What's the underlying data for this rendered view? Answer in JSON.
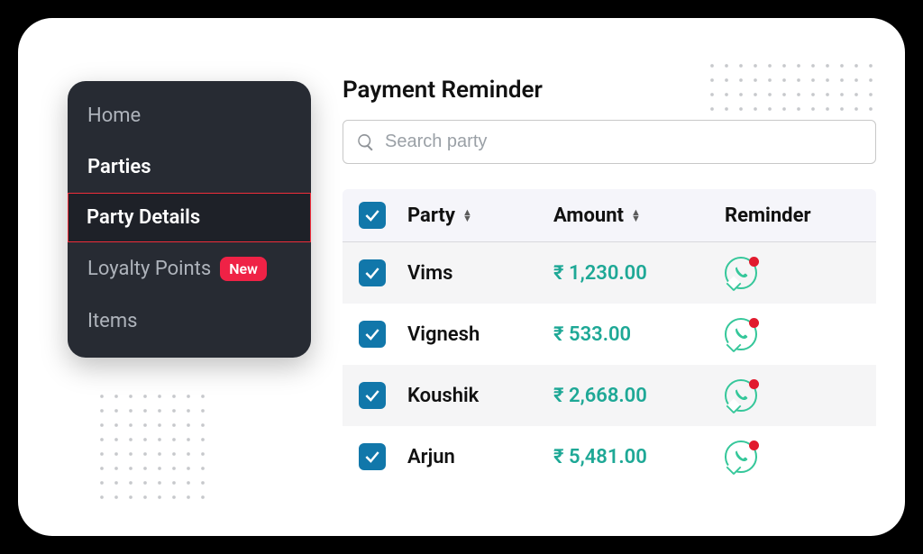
{
  "sidebar": {
    "items": [
      {
        "label": "Home"
      },
      {
        "label": "Parties"
      },
      {
        "label": "Party Details"
      },
      {
        "label": "Loyalty Points",
        "badge": "New"
      },
      {
        "label": "Items"
      }
    ]
  },
  "main": {
    "title": "Payment Reminder",
    "search_placeholder": "Search party"
  },
  "table": {
    "headers": {
      "party": "Party",
      "amount": "Amount",
      "reminder": "Reminder"
    },
    "rows": [
      {
        "party": "Vims",
        "amount": "₹ 1,230.00"
      },
      {
        "party": "Vignesh",
        "amount": "₹ 533.00"
      },
      {
        "party": "Koushik",
        "amount": "₹ 2,668.00"
      },
      {
        "party": "Arjun",
        "amount": "₹ 5,481.00"
      }
    ]
  },
  "colors": {
    "accent_red": "#ef2246",
    "teal": "#1ea896",
    "checkbox": "#1177aa"
  }
}
